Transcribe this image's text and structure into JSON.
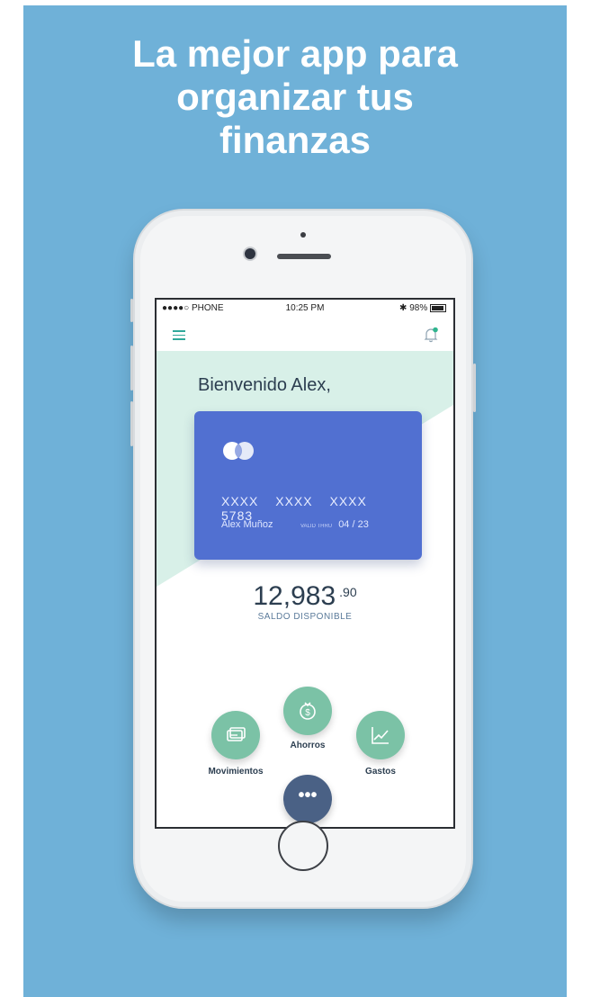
{
  "promo": {
    "headline_line1": "La mejor app para",
    "headline_line2": "organizar tus",
    "headline_line3": "finanzas",
    "background_color": "#6fb1d8"
  },
  "status_bar": {
    "carrier": "●●●●○ PHONE",
    "time": "10:25 PM",
    "battery": "98%"
  },
  "header": {
    "menu_icon": "menu-icon",
    "notification_icon": "bell-icon"
  },
  "greeting": "Bienvenido Alex,",
  "card": {
    "number_groups": [
      "XXXX",
      "XXXX",
      "XXXX",
      "5783"
    ],
    "holder": "Alex Muñoz",
    "expiry_tiny": "VALID THRU",
    "expiry": "04 / 23",
    "color": "#5170d1"
  },
  "balance": {
    "integer": "12,983",
    "decimal": ".90",
    "label": "SALDO DISPONIBLE"
  },
  "actions": {
    "movimientos": "Movimientos",
    "ahorros": "Ahorros",
    "gastos": "Gastos",
    "more": "•••"
  },
  "colors": {
    "accent": "#7bc2a6",
    "more_button": "#4a6185",
    "mint_bg": "#d8f0e8"
  }
}
